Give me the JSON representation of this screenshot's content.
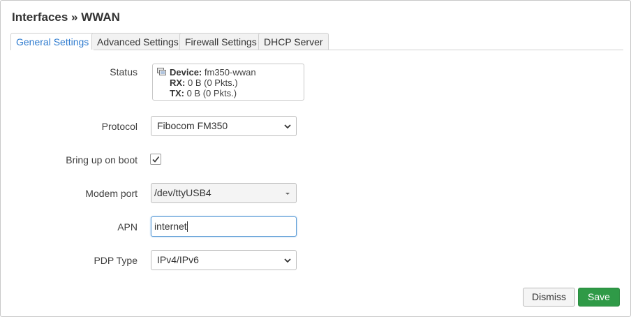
{
  "dialog": {
    "title": "Interfaces » WWAN"
  },
  "tabs": [
    {
      "label": "General Settings",
      "active": true
    },
    {
      "label": "Advanced Settings",
      "active": false
    },
    {
      "label": "Firewall Settings",
      "active": false
    },
    {
      "label": "DHCP Server",
      "active": false
    }
  ],
  "status": {
    "label": "Status",
    "device_key": "Device:",
    "device_value": "fm350-wwan",
    "rx_key": "RX:",
    "rx_value": "0 B (0 Pkts.)",
    "tx_key": "TX:",
    "tx_value": "0 B (0 Pkts.)",
    "icon": "network-device-icon"
  },
  "protocol": {
    "label": "Protocol",
    "value": "Fibocom FM350"
  },
  "bring_up_on_boot": {
    "label": "Bring up on boot",
    "checked": true
  },
  "modem_port": {
    "label": "Modem port",
    "value": "/dev/ttyUSB4"
  },
  "apn": {
    "label": "APN",
    "value": "internet"
  },
  "pdp_type": {
    "label": "PDP Type",
    "value": "IPv4/IPv6"
  },
  "buttons": {
    "dismiss": "Dismiss",
    "save": "Save"
  },
  "colors": {
    "accent_tab": "#2e7bcf",
    "save_button": "#2f9a47",
    "focus_border": "#5b9bd5"
  }
}
